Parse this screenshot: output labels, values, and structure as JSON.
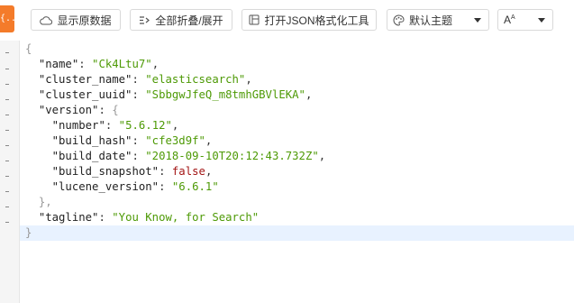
{
  "toolbar": {
    "logo_text": "{...}",
    "show_raw_label": "显示原数据",
    "fold_label": "全部折叠/展开",
    "open_tool_label": "打开JSON格式化工具",
    "theme_value": "默认主题",
    "font_value": "A",
    "icons": [
      "cloud-icon",
      "fold-icon",
      "window-icon",
      "palette-icon",
      "font-size-icon"
    ]
  },
  "colors": {
    "accent": "#f47b2a",
    "string": "#4e9a06",
    "boolean": "#a31515",
    "active_line": "#e8f2ff"
  },
  "json": {
    "open_brace": "{",
    "name_key": "\"name\"",
    "name_val": "\"Ck4Ltu7\"",
    "cluster_name_key": "\"cluster_name\"",
    "cluster_name_val": "\"elasticsearch\"",
    "cluster_uuid_key": "\"cluster_uuid\"",
    "cluster_uuid_val": "\"SbbgwJfeQ_m8tmhGBVlEKA\"",
    "version_key": "\"version\"",
    "version_open": "{",
    "number_key": "\"number\"",
    "number_val": "\"5.6.12\"",
    "build_hash_key": "\"build_hash\"",
    "build_hash_val": "\"cfe3d9f\"",
    "build_date_key": "\"build_date\"",
    "build_date_val": "\"2018-09-10T20:12:43.732Z\"",
    "build_snapshot_key": "\"build_snapshot\"",
    "build_snapshot_val": "false",
    "lucene_version_key": "\"lucene_version\"",
    "lucene_version_val": "\"6.6.1\"",
    "version_close": "},",
    "tagline_key": "\"tagline\"",
    "tagline_val": "\"You Know, for Search\"",
    "close_brace": "}"
  }
}
